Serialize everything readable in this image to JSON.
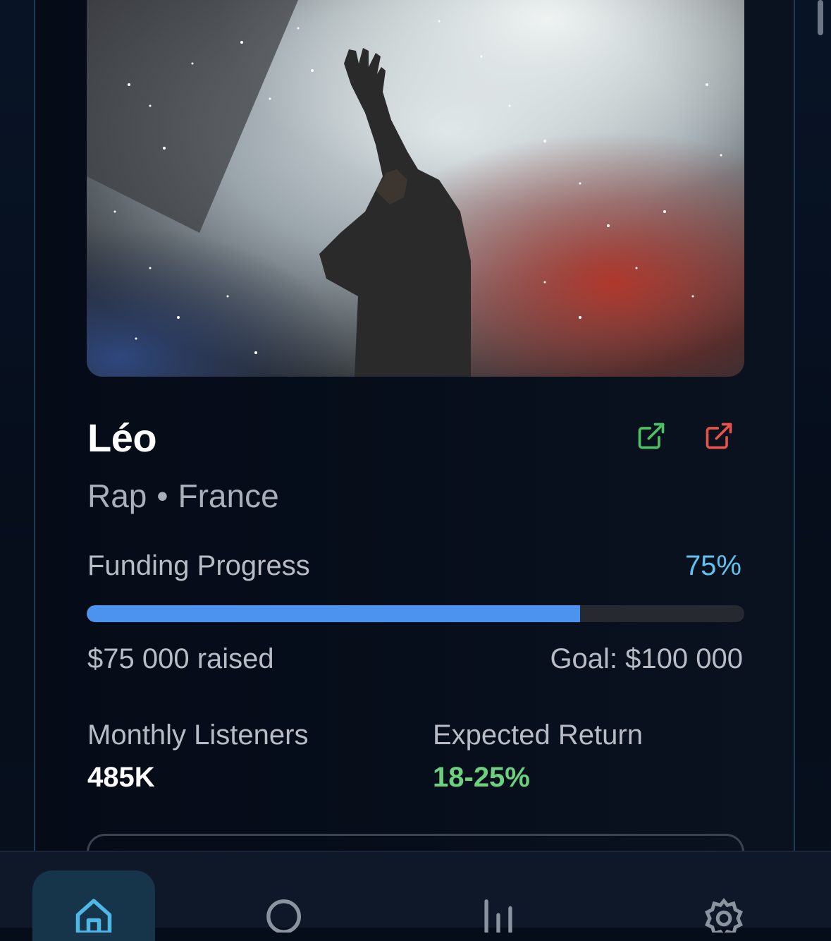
{
  "artist": {
    "name": "Léo",
    "genre": "Rap",
    "separator": "•",
    "country": "France",
    "image_alt": "Performer raising hand on a smoky concert stage"
  },
  "funding": {
    "label": "Funding Progress",
    "percent_text": "75%",
    "progress_fraction": 0.75,
    "raised_text": "$75 000 raised",
    "goal_text": "Goal: $100 000"
  },
  "stats": {
    "monthly_listeners_label": "Monthly Listeners",
    "monthly_listeners_value": "485K",
    "expected_return_label": "Expected Return",
    "expected_return_value": "18-25%"
  },
  "icons": {
    "external_link_green": "external-link-icon",
    "external_link_red": "external-link-icon",
    "nav": [
      "home-icon",
      "search-icon",
      "stats-icon",
      "gear-icon"
    ]
  },
  "colors": {
    "accent_blue": "#4b93ee",
    "percent_blue": "#5ec3ee",
    "return_green": "#6dd07f",
    "link_green": "#4fbf63",
    "link_red": "#e5534b",
    "nav_active": "#4fb7e6"
  }
}
